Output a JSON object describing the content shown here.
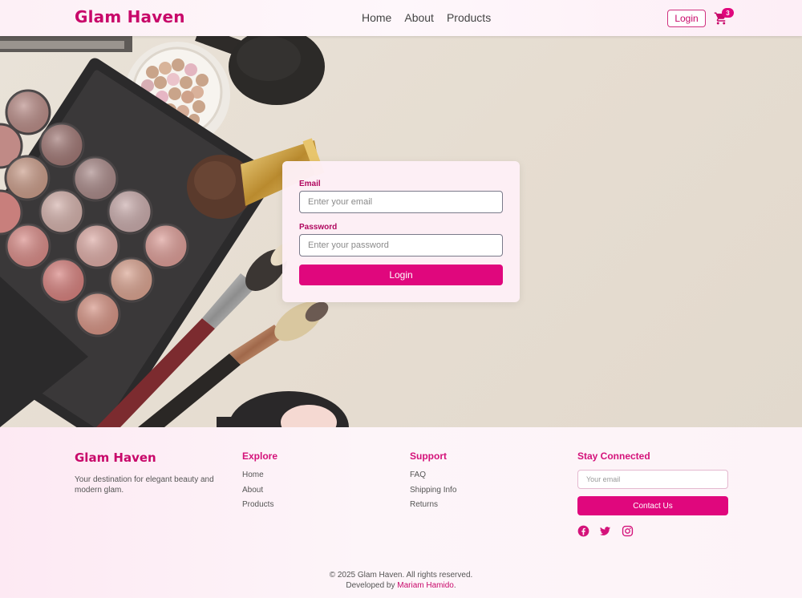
{
  "header": {
    "brand": "Glam Haven",
    "nav": [
      "Home",
      "About",
      "Products"
    ],
    "login_label": "Login",
    "cart_count": "3",
    "cart_icon": "shopping-cart-icon"
  },
  "login_form": {
    "email_label": "Email",
    "email_placeholder": "Enter your email",
    "password_label": "Password",
    "password_placeholder": "Enter your password",
    "submit_label": "Login"
  },
  "footer": {
    "brand": "Glam Haven",
    "description": "Your destination for elegant beauty and modern glam.",
    "explore": {
      "title": "Explore",
      "links": [
        "Home",
        "About",
        "Products"
      ]
    },
    "support": {
      "title": "Support",
      "links": [
        "FAQ",
        "Shipping Info",
        "Returns"
      ]
    },
    "stay_connected": {
      "title": "Stay Connected",
      "email_placeholder": "Your email",
      "contact_label": "Contact Us",
      "social_icons": [
        "facebook-icon",
        "twitter-icon",
        "instagram-icon"
      ]
    },
    "copyright": "© 2025 Glam Haven. All rights reserved.",
    "developed_by_prefix": "Developed by",
    "developer_name": "Mariam Hamido",
    "developed_by_suffix": "."
  },
  "colors": {
    "accent": "#e0077d",
    "brand": "#c8086a",
    "footer_heading": "#d4127a"
  }
}
